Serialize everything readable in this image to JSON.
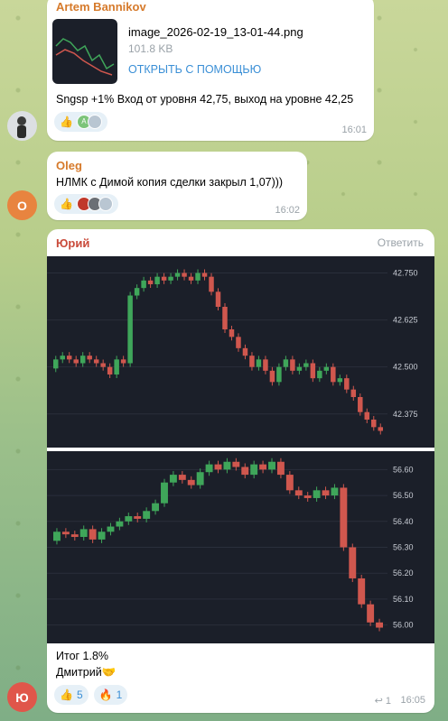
{
  "messages": [
    {
      "sender": "Artem Bannikov",
      "sender_color": "#d67a2b",
      "file": {
        "name": "image_2026-02-19_13-01-44.png",
        "size": "101.8 KB",
        "open_label": "ОТКРЫТЬ С ПОМОЩЬЮ"
      },
      "text": "Sngsp +1% Вход от уровня 42,75, выход на уровне 42,25",
      "reaction_emoji": "👍",
      "reaction_badge": "A",
      "time": "16:01"
    },
    {
      "sender": "Oleg",
      "sender_color": "#d67a2b",
      "avatar_letter": "O",
      "avatar_color": "#e8843f",
      "text": "НЛМК с Димой копия сделки закрыл 1,07)))",
      "reaction_emoji": "👍",
      "time": "16:02"
    },
    {
      "sender": "Юрий",
      "sender_color": "#c94a3a",
      "reply_label": "Ответить",
      "avatar_letter": "Ю",
      "avatar_color": "#e0564a",
      "text_line1": "Итог 1.8%",
      "text_line2": "Дмитрий🤝",
      "reactions": [
        {
          "emoji": "👍",
          "count": "5"
        },
        {
          "emoji": "🔥",
          "count": "1"
        }
      ],
      "replies": "1",
      "time": "16:05"
    }
  ],
  "chart_data": [
    {
      "type": "candlestick",
      "yticks": [
        "42.750",
        "42.625",
        "42.500",
        "42.375"
      ],
      "ylim": [
        42.3,
        42.78
      ],
      "series_close": [
        42.52,
        42.53,
        42.52,
        42.51,
        42.53,
        42.52,
        42.51,
        42.5,
        42.48,
        42.52,
        42.51,
        42.69,
        42.71,
        42.73,
        42.72,
        42.74,
        42.73,
        42.74,
        42.75,
        42.74,
        42.73,
        42.75,
        42.74,
        42.7,
        42.66,
        42.6,
        42.58,
        42.55,
        42.53,
        42.5,
        42.52,
        42.49,
        42.46,
        42.5,
        42.52,
        42.49,
        42.5,
        42.51,
        42.47,
        42.49,
        42.5,
        42.46,
        42.47,
        42.44,
        42.42,
        42.38,
        42.36,
        42.34,
        42.33
      ]
    },
    {
      "type": "candlestick",
      "yticks": [
        "56.60",
        "56.50",
        "56.40",
        "56.30",
        "56.20",
        "56.10",
        "56.00"
      ],
      "ylim": [
        55.95,
        56.65
      ],
      "series_close": [
        56.36,
        56.35,
        56.34,
        56.37,
        56.33,
        56.36,
        56.38,
        56.4,
        56.42,
        56.41,
        56.44,
        56.47,
        56.55,
        56.58,
        56.56,
        56.54,
        56.59,
        56.62,
        56.6,
        56.63,
        56.61,
        56.58,
        56.62,
        56.6,
        56.63,
        56.58,
        56.52,
        56.5,
        56.49,
        56.52,
        56.5,
        56.53,
        56.3,
        56.18,
        56.08,
        56.01,
        55.99
      ]
    }
  ]
}
